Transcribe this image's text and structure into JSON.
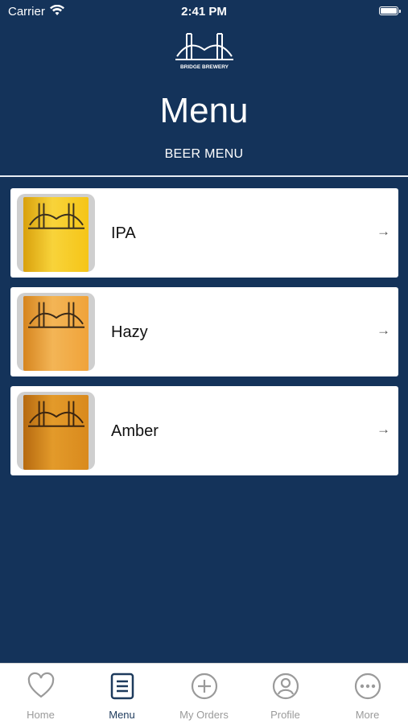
{
  "status_bar": {
    "carrier": "Carrier",
    "time": "2:41 PM"
  },
  "header": {
    "logo_text": "BRIDGE BREWERY",
    "title": "Menu",
    "subtitle": "BEER MENU"
  },
  "menu": {
    "items": [
      {
        "label": "IPA",
        "color": "#f1c21c"
      },
      {
        "label": "Hazy",
        "color": "#f0a63a"
      },
      {
        "label": "Amber",
        "color": "#d98a1d"
      }
    ]
  },
  "tabs": [
    {
      "label": "Home",
      "icon": "heart-icon"
    },
    {
      "label": "Menu",
      "icon": "list-icon"
    },
    {
      "label": "My Orders",
      "icon": "plus-circle-icon"
    },
    {
      "label": "Profile",
      "icon": "profile-icon"
    },
    {
      "label": "More",
      "icon": "more-icon"
    }
  ],
  "colors": {
    "background": "#14335a",
    "active_tab": "#1d3a5c",
    "inactive_tab": "#9a9a9a"
  }
}
